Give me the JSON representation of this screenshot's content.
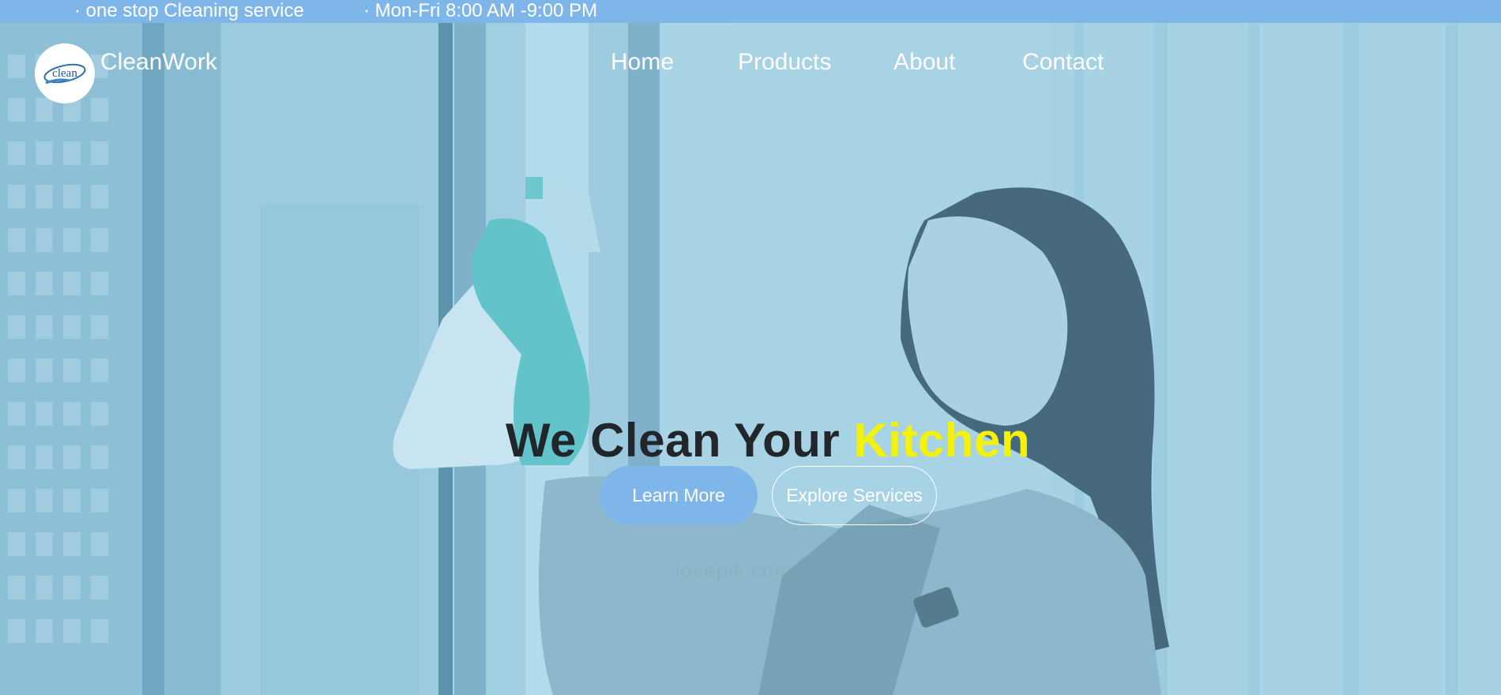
{
  "topbar": {
    "tagline": "· one stop Cleaning service",
    "hours": "· Mon-Fri 8:00 AM -9:00 PM"
  },
  "header": {
    "logo_text": "clean",
    "brand_name": "CleanWork",
    "nav": {
      "home": "Home",
      "products": "Products",
      "about": "About",
      "contact": "Contact"
    }
  },
  "hero": {
    "headline_main": "We Clean Your ",
    "headline_accent": "Kitchen",
    "learn_more_label": "Learn More",
    "explore_label": "Explore Services",
    "watermark": "lovepik.com"
  },
  "colors": {
    "topbar": "#7fb6ea",
    "accent": "#f5f20a",
    "primary_button": "#7fb6ea",
    "overlay": "#a9d5e7",
    "headline": "#22262a"
  },
  "icons": {
    "logo": "clean-logo-icon"
  }
}
